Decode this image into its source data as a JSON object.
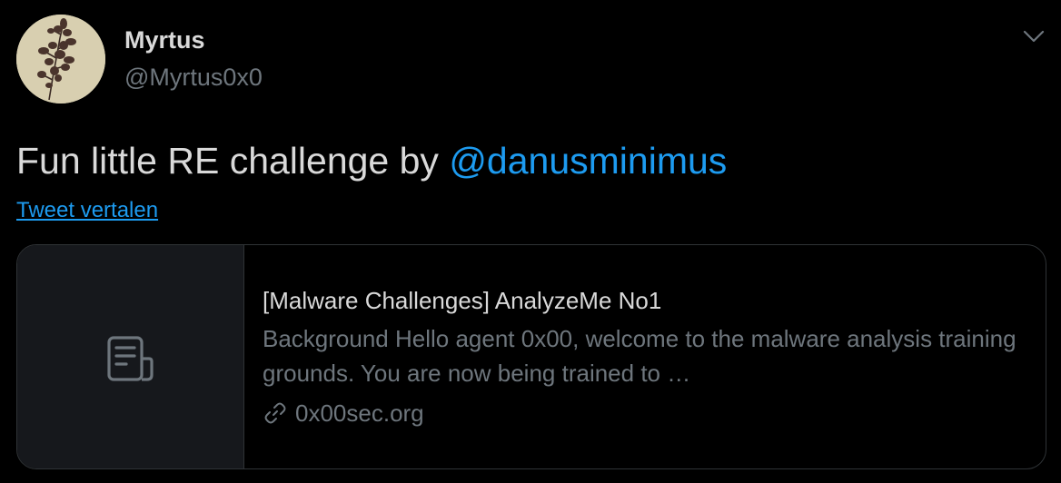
{
  "author": {
    "display_name": "Myrtus",
    "handle": "@Myrtus0x0"
  },
  "tweet": {
    "text_prefix": "Fun little RE challenge by ",
    "mention": "@danusminimus",
    "translate_label": "Tweet vertalen"
  },
  "card": {
    "title": "[Malware Challenges] AnalyzeMe No1",
    "description": "Background Hello agent 0x00, welcome to the malware analysis training grounds. You are now being trained to …",
    "domain": "0x00sec.org",
    "thumbnail_icon": "document-icon",
    "domain_icon": "link-icon"
  },
  "icons": {
    "menu": "chevron-down-icon"
  },
  "colors": {
    "background": "#000000",
    "text": "#d9d9d9",
    "muted": "#6e767d",
    "accent": "#1d9bf0",
    "border": "#2f3336"
  }
}
